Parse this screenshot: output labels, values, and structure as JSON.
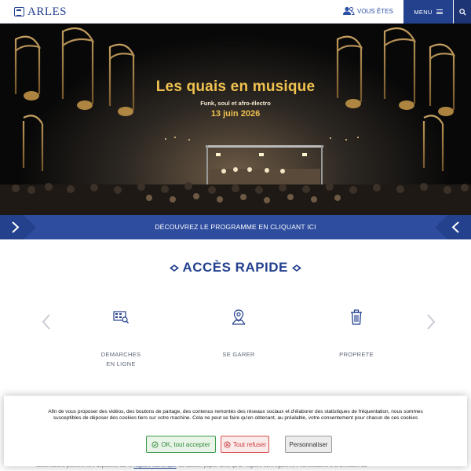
{
  "header": {
    "logo_text": "ARLES",
    "who_label": "VOUS ÊTES",
    "menu_label": "MENU"
  },
  "hero": {
    "title": "Les quais en musique",
    "subtitle": "Funk, soul et afro-électro",
    "date": "13 juin 2026"
  },
  "banner": {
    "text": "DÉCOUVREZ LE PROGRAMME EN CLIQUANT ICI"
  },
  "quick_access": {
    "title": "ACCÈS RAPIDE",
    "items": [
      {
        "line1": "DEMARCHES",
        "line2": "EN LIGNE",
        "icon": "online-procedures-icon"
      },
      {
        "line1": "SE GARER",
        "line2": "",
        "icon": "parking-location-icon"
      },
      {
        "line1": "PROPRETE",
        "line2": "",
        "icon": "trash-icon"
      }
    ]
  },
  "behind_text": {
    "before": "observations peuvent être déposées sur le ",
    "link": "registre numérique",
    "after": ". Le dossier papier ainsi qu'un registre sont également consultables à la Direction du"
  },
  "cookie": {
    "text": "Afin de vous proposer des vidéos, des boutons de partage, des contenus remontés des réseaux sociaux et d'élaborer des statistiques de fréquentation, nous sommes susceptibles de déposer des cookies tiers sur votre machine. Cela ne peut se faire qu'en obtenant, au préalable, votre consentement pour chacun de ces cookies",
    "accept_label": "OK, tout accepter",
    "refuse_label": "Tout refuser",
    "customize_label": "Personnaliser"
  },
  "colors": {
    "brand_blue": "#24418e",
    "banner_blue": "#2e4d9f",
    "gold": "#f0c24f",
    "accept_green": "#3e9a49",
    "refuse_red": "#d55151"
  }
}
